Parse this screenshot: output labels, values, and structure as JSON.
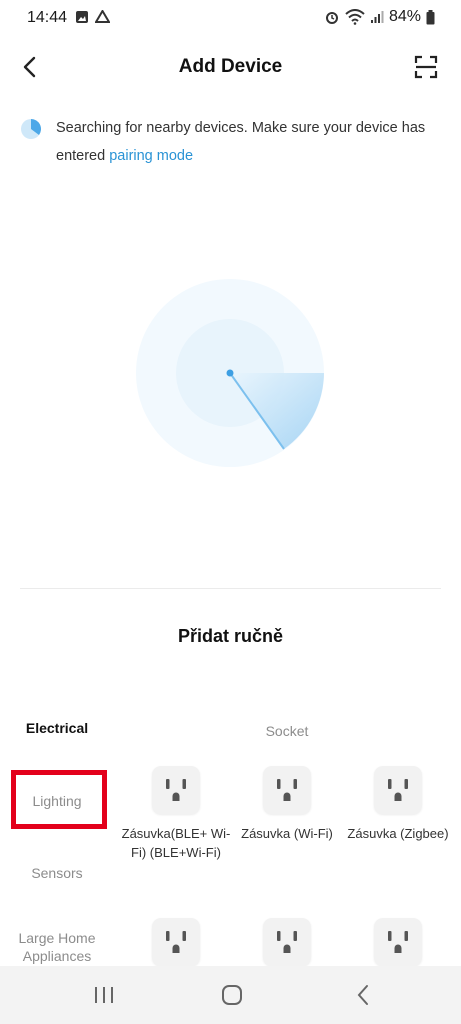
{
  "status_bar": {
    "time": "14:44",
    "battery": "84%",
    "icons": [
      "gallery-icon",
      "drive-icon",
      "alarm-icon",
      "wifi-icon",
      "signal-icon",
      "battery-icon"
    ]
  },
  "header": {
    "title": "Add Device",
    "back_icon": "chevron-left-icon",
    "scan_icon": "scan-icon"
  },
  "info": {
    "text": "Searching for nearby devices. Make sure your device has entered ",
    "link": "pairing mode"
  },
  "manual": {
    "title": "Přidat ručně"
  },
  "categories": [
    {
      "label": "Electrical",
      "active": true
    },
    {
      "label": "Lighting",
      "active": false
    },
    {
      "label": "Sensors",
      "active": false
    },
    {
      "label": "Large Home Appliances",
      "active": false
    }
  ],
  "section": {
    "label": "Socket"
  },
  "devices": [
    {
      "name": "Zásuvka(BLE+ Wi-Fi) (BLE+Wi-Fi)"
    },
    {
      "name": "Zásuvka (Wi-Fi)"
    },
    {
      "name": "Zásuvka (Zigbee)"
    },
    {
      "name": ""
    },
    {
      "name": ""
    },
    {
      "name": ""
    }
  ],
  "colors": {
    "accent": "#2a93d5",
    "highlight": "#e3001b",
    "radar": "#bfe0f7"
  }
}
